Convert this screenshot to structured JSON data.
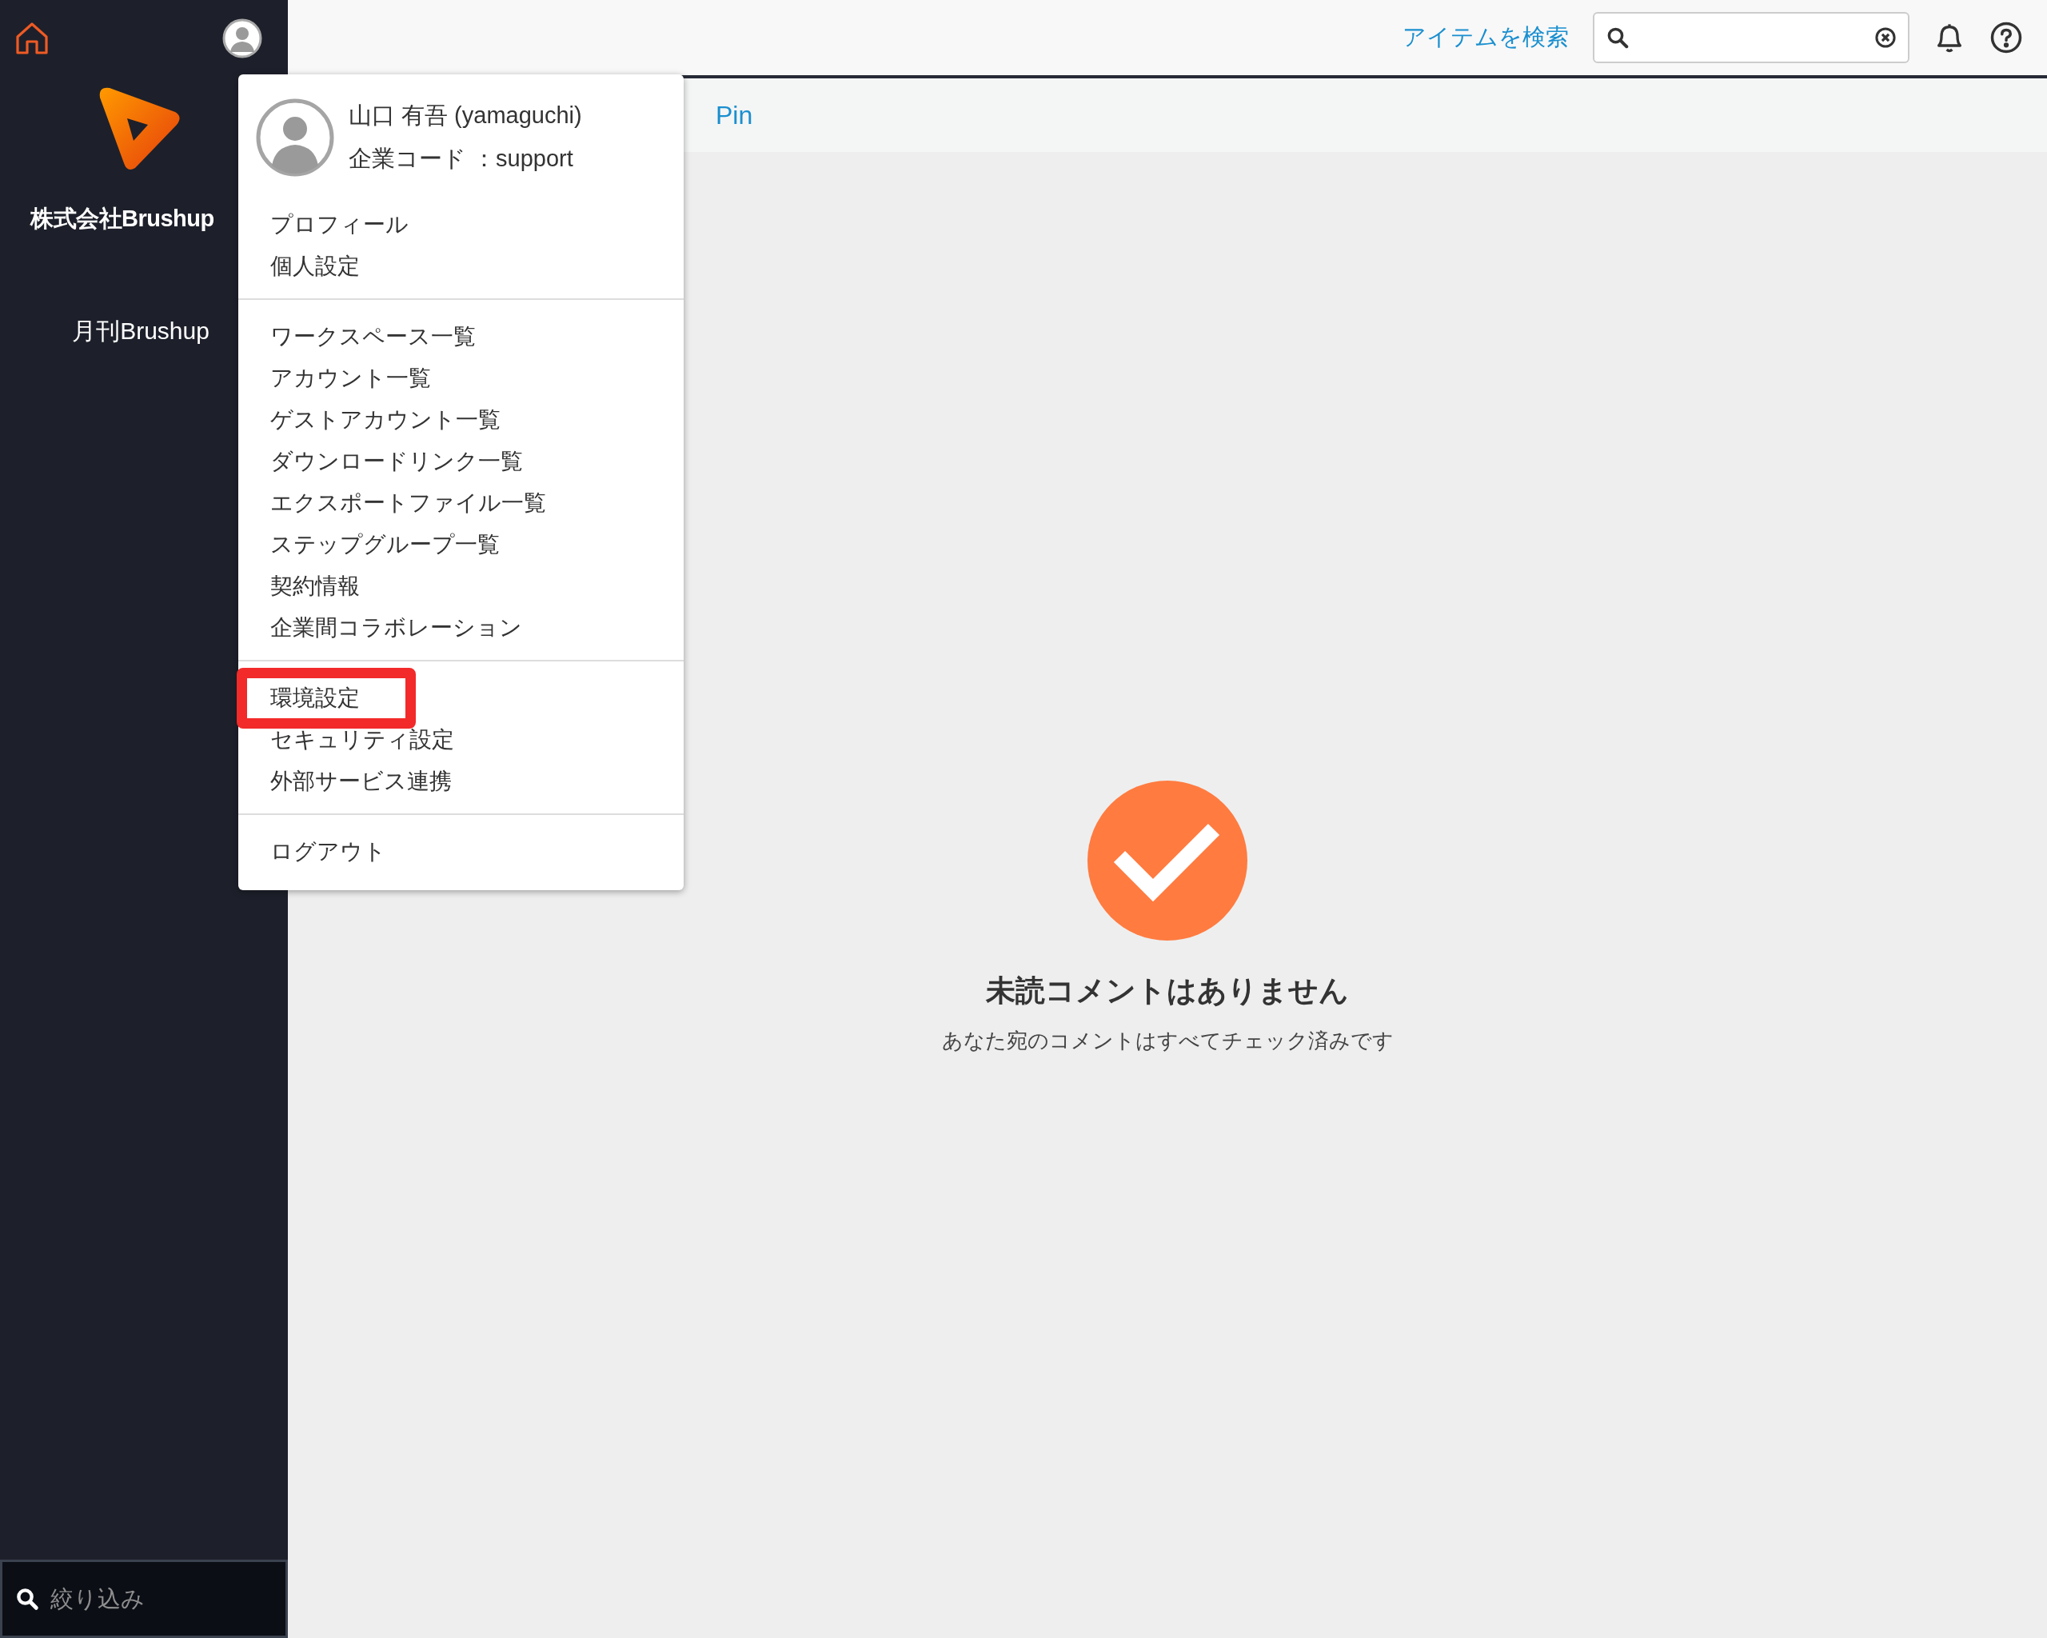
{
  "sidebar": {
    "company": "株式会社Brushup",
    "items": [
      {
        "label": "月刊Brushup"
      }
    ],
    "filter": {
      "placeholder": "絞り込み"
    }
  },
  "top_bar": {
    "search_link": "アイテムを検索"
  },
  "sub_bar": {
    "tab": "Pin"
  },
  "user_menu": {
    "name": "山口 有吾 (yamaguchi)",
    "company_code": "企業コード ：support",
    "sections": [
      [
        {
          "label": "プロフィール",
          "highlighted": false
        },
        {
          "label": "個人設定",
          "highlighted": false
        }
      ],
      [
        {
          "label": "ワークスペース一覧",
          "highlighted": false
        },
        {
          "label": "アカウント一覧",
          "highlighted": false
        },
        {
          "label": "ゲストアカウント一覧",
          "highlighted": false
        },
        {
          "label": "ダウンロードリンク一覧",
          "highlighted": false
        },
        {
          "label": "エクスポートファイル一覧",
          "highlighted": false
        },
        {
          "label": "ステップグループ一覧",
          "highlighted": false
        },
        {
          "label": "契約情報",
          "highlighted": false
        },
        {
          "label": "企業間コラボレーション",
          "highlighted": false
        }
      ],
      [
        {
          "label": "環境設定",
          "highlighted": true
        },
        {
          "label": "セキュリティ設定",
          "highlighted": false
        },
        {
          "label": "外部サービス連携",
          "highlighted": false
        }
      ],
      [
        {
          "label": "ログアウト",
          "highlighted": false
        }
      ]
    ]
  },
  "empty_state": {
    "title": "未読コメントはありません",
    "message": "あなた宛のコメントはすべてチェック済みです"
  }
}
